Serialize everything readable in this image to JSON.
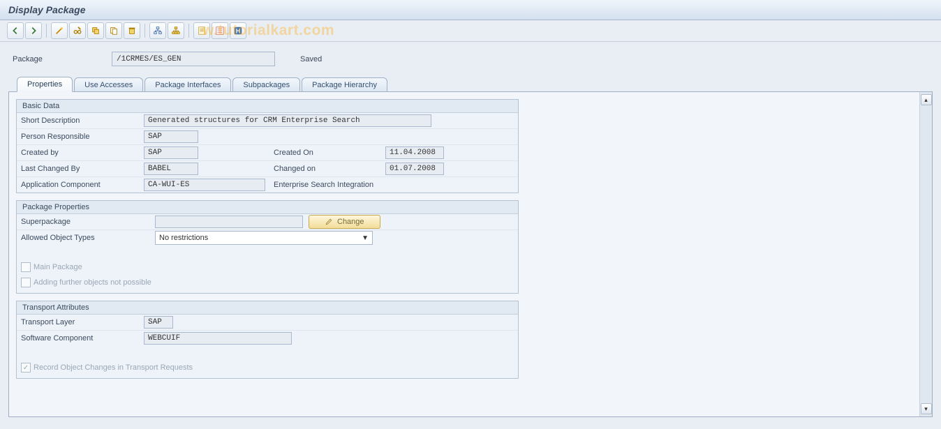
{
  "title": "Display Package",
  "watermark": "w.tutorialkart.com",
  "toolbar": {
    "back": "arrow-left",
    "forward": "arrow-right",
    "wand": "wand",
    "edit": "pencil",
    "other": "object",
    "copy": "copy",
    "delete": "delete",
    "tree": "tree",
    "hier": "hierarchy-icon",
    "doc": "document",
    "list": "list-icon",
    "info": "info-icon"
  },
  "header": {
    "package_label": "Package",
    "package_value": "/1CRMES/ES_GEN",
    "status": "Saved"
  },
  "tabs": [
    {
      "id": "properties",
      "label": "Properties",
      "active": true
    },
    {
      "id": "use_accesses",
      "label": "Use Accesses",
      "active": false
    },
    {
      "id": "package_interfaces",
      "label": "Package Interfaces",
      "active": false
    },
    {
      "id": "subpackages",
      "label": "Subpackages",
      "active": false
    },
    {
      "id": "package_hierarchy",
      "label": "Package Hierarchy",
      "active": false
    }
  ],
  "groups": {
    "basic": {
      "title": "Basic Data",
      "short_desc_label": "Short Description",
      "short_desc": "Generated structures for CRM Enterprise Search",
      "person_resp_label": "Person Responsible",
      "person_resp": "SAP",
      "created_by_label": "Created by",
      "created_by": "SAP",
      "created_on_label": "Created On",
      "created_on": "11.04.2008",
      "last_changed_by_label": "Last Changed By",
      "last_changed_by": "BABEL",
      "changed_on_label": "Changed on",
      "changed_on": "01.07.2008",
      "app_comp_label": "Application Component",
      "app_comp": "CA-WUI-ES",
      "app_comp_text": "Enterprise Search Integration"
    },
    "pkgprops": {
      "title": "Package Properties",
      "superpackage_label": "Superpackage",
      "superpackage": "",
      "change_btn": "Change",
      "allowed_types_label": "Allowed Object Types",
      "allowed_types": "No restrictions",
      "main_pkg_label": "Main Package",
      "adding_label": "Adding further objects not possible"
    },
    "transport": {
      "title": "Transport Attributes",
      "layer_label": "Transport Layer",
      "layer": "SAP",
      "sw_comp_label": "Software Component",
      "sw_comp": "WEBCUIF",
      "record_label": "Record Object Changes in Transport Requests"
    }
  }
}
